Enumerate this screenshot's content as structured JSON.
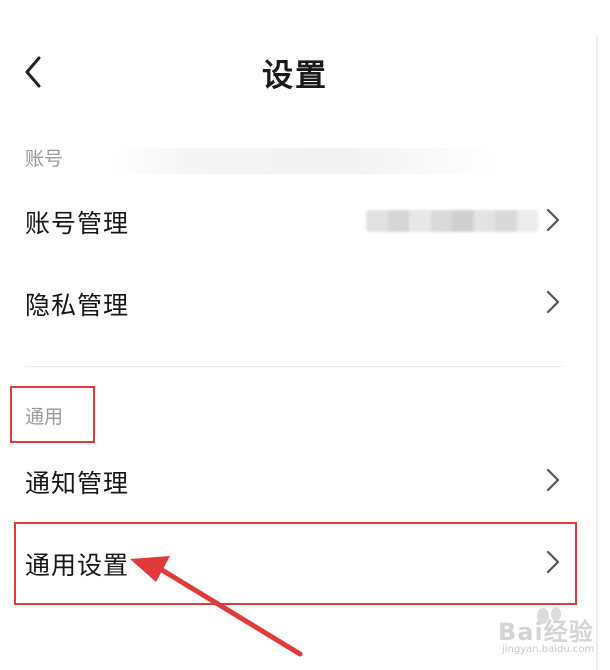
{
  "header": {
    "title": "设置",
    "back_icon": "chevron-left-icon"
  },
  "sections": [
    {
      "label": "账号",
      "items": [
        {
          "label": "账号管理",
          "value": "",
          "value_blurred": true,
          "icon": "chevron-right-icon"
        },
        {
          "label": "隐私管理",
          "icon": "chevron-right-icon"
        }
      ]
    },
    {
      "label": "通用",
      "items": [
        {
          "label": "通知管理",
          "icon": "chevron-right-icon"
        },
        {
          "label": "通用设置",
          "icon": "chevron-right-icon"
        }
      ]
    }
  ],
  "annotations": {
    "highlight_color": "#e03a3a",
    "highlight_targets": [
      "通用",
      "通用设置"
    ],
    "arrow_target": "通用设置"
  },
  "watermark": {
    "brand": "Bai经验",
    "sub": "jingyan.baidu.com"
  }
}
